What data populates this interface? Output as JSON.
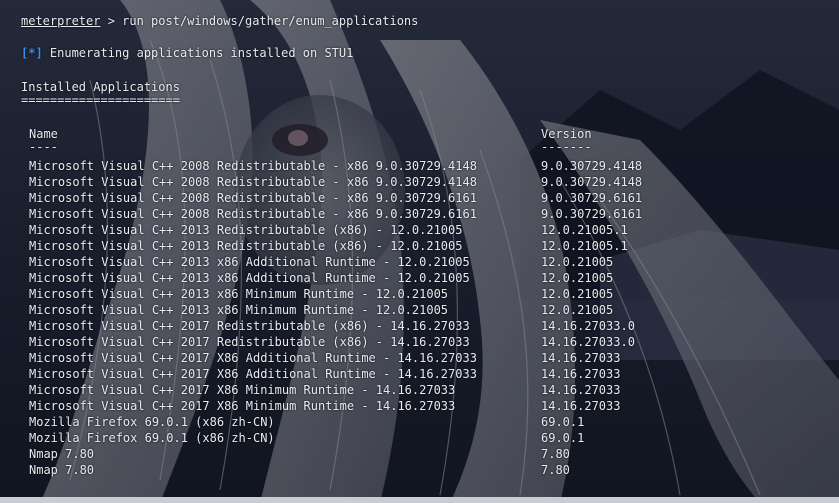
{
  "terminal": {
    "prompt_word": "meterpreter",
    "prompt_rest": " > run post/windows/gather/enum_applications",
    "status_tag": "[*]",
    "status_text": " Enumerating applications installed on STU1",
    "section_title": "Installed Applications",
    "section_rule": "======================",
    "col_name": "Name",
    "col_name_rule": "----",
    "col_version": "Version",
    "col_version_rule": "-------",
    "rows": [
      {
        "name": "Microsoft Visual C++ 2008 Redistributable - x86 9.0.30729.4148",
        "version": "9.0.30729.4148"
      },
      {
        "name": "Microsoft Visual C++ 2008 Redistributable - x86 9.0.30729.4148",
        "version": "9.0.30729.4148"
      },
      {
        "name": "Microsoft Visual C++ 2008 Redistributable - x86 9.0.30729.6161",
        "version": "9.0.30729.6161"
      },
      {
        "name": "Microsoft Visual C++ 2008 Redistributable - x86 9.0.30729.6161",
        "version": "9.0.30729.6161"
      },
      {
        "name": "Microsoft Visual C++ 2013 Redistributable (x86) - 12.0.21005",
        "version": "12.0.21005.1"
      },
      {
        "name": "Microsoft Visual C++ 2013 Redistributable (x86) - 12.0.21005",
        "version": "12.0.21005.1"
      },
      {
        "name": "Microsoft Visual C++ 2013 x86 Additional Runtime - 12.0.21005",
        "version": "12.0.21005"
      },
      {
        "name": "Microsoft Visual C++ 2013 x86 Additional Runtime - 12.0.21005",
        "version": "12.0.21005"
      },
      {
        "name": "Microsoft Visual C++ 2013 x86 Minimum Runtime - 12.0.21005",
        "version": "12.0.21005"
      },
      {
        "name": "Microsoft Visual C++ 2013 x86 Minimum Runtime - 12.0.21005",
        "version": "12.0.21005"
      },
      {
        "name": "Microsoft Visual C++ 2017 Redistributable (x86) - 14.16.27033",
        "version": "14.16.27033.0"
      },
      {
        "name": "Microsoft Visual C++ 2017 Redistributable (x86) - 14.16.27033",
        "version": "14.16.27033.0"
      },
      {
        "name": "Microsoft Visual C++ 2017 X86 Additional Runtime - 14.16.27033",
        "version": "14.16.27033"
      },
      {
        "name": "Microsoft Visual C++ 2017 X86 Additional Runtime - 14.16.27033",
        "version": "14.16.27033"
      },
      {
        "name": "Microsoft Visual C++ 2017 X86 Minimum Runtime - 14.16.27033",
        "version": "14.16.27033"
      },
      {
        "name": "Microsoft Visual C++ 2017 X86 Minimum Runtime - 14.16.27033",
        "version": "14.16.27033"
      },
      {
        "name": "Mozilla Firefox 69.0.1 (x86 zh-CN)",
        "version": "69.0.1"
      },
      {
        "name": "Mozilla Firefox 69.0.1 (x86 zh-CN)",
        "version": "69.0.1"
      },
      {
        "name": "Nmap 7.80",
        "version": "7.80"
      },
      {
        "name": "Nmap 7.80",
        "version": "7.80"
      }
    ]
  },
  "colors": {
    "text": "#e8eaee",
    "status_tag": "#3b8ef0",
    "background": "#1a2030"
  }
}
